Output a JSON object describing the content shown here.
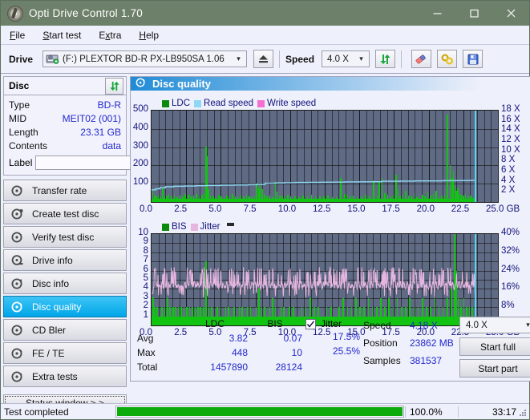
{
  "window": {
    "title": "Opti Drive Control 1.70",
    "icon": "disc-icon",
    "minimize": "–",
    "maximize": "☐",
    "close": "✕"
  },
  "menubar": {
    "items": [
      {
        "label": "File",
        "accel": "F"
      },
      {
        "label": "Start test",
        "accel": "S"
      },
      {
        "label": "Extra",
        "accel": "x"
      },
      {
        "label": "Help",
        "accel": "H"
      }
    ]
  },
  "toolbar": {
    "drive_label": "Drive",
    "drive_value": "(F:)  PLEXTOR BD-R  PX-LB950SA 1.06",
    "eject_icon": "eject-icon",
    "speed_label": "Speed",
    "speed_value": "4.0 X",
    "refresh_icon": "refresh-icon",
    "erase_icon": "eraser-icon",
    "tools_icon": "tools-icon",
    "save_icon": "save-icon"
  },
  "disc": {
    "title": "Disc",
    "refresh_icon": "refresh-icon",
    "rows": [
      {
        "key": "Type",
        "value": "BD-R"
      },
      {
        "key": "MID",
        "value": "MEIT02 (001)"
      },
      {
        "key": "Length",
        "value": "23.31 GB"
      },
      {
        "key": "Contents",
        "value": "data"
      }
    ],
    "label_key": "Label",
    "label_value": "",
    "label_placeholder": "",
    "label_button_icon": "cd-icon"
  },
  "sidebar": {
    "items": [
      {
        "label": "Transfer rate",
        "icon": "disc-test-icon",
        "active": false
      },
      {
        "label": "Create test disc",
        "icon": "disc-burn-icon",
        "active": false
      },
      {
        "label": "Verify test disc",
        "icon": "disc-verify-icon",
        "active": false
      },
      {
        "label": "Drive info",
        "icon": "drive-info-icon",
        "active": false
      },
      {
        "label": "Disc info",
        "icon": "disc-info-icon",
        "active": false
      },
      {
        "label": "Disc quality",
        "icon": "disc-quality-icon",
        "active": true
      },
      {
        "label": "CD Bler",
        "icon": "cd-bler-icon",
        "active": false
      },
      {
        "label": "FE / TE",
        "icon": "fe-te-icon",
        "active": false
      },
      {
        "label": "Extra tests",
        "icon": "extra-tests-icon",
        "active": false
      }
    ],
    "status_window_button": "Status window > >"
  },
  "pane": {
    "title": "Disc quality",
    "icon": "disc-quality-icon"
  },
  "stats": {
    "col_headers": [
      "",
      "LDC",
      "BIS"
    ],
    "rows": [
      {
        "label": "Avg",
        "ldc": "3.82",
        "bis": "0.07",
        "jitter": "17.5%"
      },
      {
        "label": "Max",
        "ldc": "448",
        "bis": "10",
        "jitter": "25.5%"
      },
      {
        "label": "Total",
        "ldc": "1457890",
        "bis": "28124",
        "jitter": ""
      }
    ],
    "jitter_label": "Jitter",
    "jitter_checked": true,
    "speed_label": "Speed",
    "speed_value": "4.18 X",
    "position_label": "Position",
    "position_value": "23862 MB",
    "samples_label": "Samples",
    "samples_value": "381537",
    "speed_select": "4.0 X",
    "start_full": "Start full",
    "start_part": "Start part"
  },
  "statusbar": {
    "text": "Test completed",
    "percent": "100.0%",
    "progress": 100,
    "time": "33:17"
  },
  "colors": {
    "titlebar": "#6d8069",
    "plot_bg": "#5f6b84",
    "ldc_green": "#12c412",
    "read_speed": "#8fd8f5",
    "write_speed": "#f56fd0",
    "jitter_pink": "#e7b6e0",
    "accent_blue": "#1f8bd6",
    "value_blue": "#2228cc",
    "progress_green": "#0bab0b"
  },
  "chart_data": [
    {
      "type": "line",
      "name": "top-chart-ldc-speed",
      "title": "",
      "xlabel": "GB",
      "ylabel": "LDC",
      "y2label": "X",
      "xlim": [
        0,
        25.0
      ],
      "ylim": [
        0,
        500
      ],
      "y2lim": [
        0,
        18
      ],
      "grid": true,
      "legend_position": "top-left",
      "xticks": [
        "0.0",
        "2.5",
        "5.0",
        "7.5",
        "10.0",
        "12.5",
        "15.0",
        "17.5",
        "20.0",
        "22.5",
        "25.0 GB"
      ],
      "xtick_values": [
        0,
        2.5,
        5,
        7.5,
        10,
        12.5,
        15,
        17.5,
        20,
        22.5,
        25
      ],
      "yticks": [
        "100",
        "200",
        "300",
        "400",
        "500"
      ],
      "ytick_values": [
        100,
        200,
        300,
        400,
        500
      ],
      "y2ticks": [
        "2 X",
        "4 X",
        "6 X",
        "8 X",
        "10 X",
        "12 X",
        "14 X",
        "16 X",
        "18 X"
      ],
      "y2tick_values": [
        2,
        4,
        6,
        8,
        10,
        12,
        14,
        16,
        18
      ],
      "legend": [
        {
          "name": "LDC",
          "color": "#0b8a0b"
        },
        {
          "name": "Read speed",
          "color": "#8fd8f5"
        },
        {
          "name": "Write speed",
          "color": "#f56fd0"
        }
      ],
      "series": [
        {
          "name": "LDC",
          "color": "#12c412",
          "type": "impulse",
          "x": [
            0.05,
            0.18,
            0.3,
            0.45,
            0.6,
            0.75,
            0.9,
            1.05,
            1.2,
            1.4,
            1.6,
            1.8,
            2.0,
            2.2,
            2.4,
            2.6,
            2.8,
            3.0,
            3.2,
            3.4,
            3.6,
            3.75,
            3.9,
            3.95,
            4.05,
            4.2,
            4.4,
            4.6,
            4.8,
            5.0,
            5.2,
            5.4,
            5.6,
            5.8,
            6.0,
            6.2,
            6.4,
            6.6,
            6.8,
            7.0,
            7.2,
            7.4,
            7.55,
            7.7,
            7.8,
            7.95,
            8.1,
            8.3,
            8.5,
            8.7,
            8.9,
            9.0,
            9.2,
            9.4,
            9.6,
            9.8,
            10.0,
            10.3,
            10.6,
            10.9,
            11.2,
            11.5,
            11.8,
            12.1,
            12.4,
            12.7,
            13.0,
            13.3,
            13.6,
            13.9,
            14.1,
            14.3,
            14.5,
            14.8,
            15.1,
            15.4,
            15.7,
            16.0,
            16.25,
            16.4,
            16.6,
            16.8,
            17.0,
            17.2,
            17.4,
            17.6,
            17.75,
            17.9,
            18.1,
            18.3,
            18.5,
            18.7,
            18.9,
            19.1,
            19.3,
            19.5,
            19.7,
            19.9,
            20.1,
            20.3,
            20.5,
            20.7,
            20.9,
            21.1,
            21.3,
            21.5,
            21.65,
            21.75,
            21.85,
            21.95,
            22.05,
            22.15,
            22.3,
            22.45,
            22.6,
            22.8,
            23.0,
            23.2,
            23.35
          ],
          "y": [
            70,
            35,
            30,
            40,
            28,
            80,
            30,
            35,
            45,
            30,
            40,
            28,
            35,
            30,
            45,
            38,
            30,
            35,
            42,
            30,
            38,
            50,
            303,
            250,
            70,
            35,
            30,
            28,
            40,
            32,
            28,
            35,
            30,
            42,
            30,
            28,
            35,
            30,
            38,
            30,
            25,
            35,
            100,
            75,
            95,
            70,
            40,
            30,
            35,
            28,
            110,
            55,
            35,
            30,
            28,
            40,
            32,
            30,
            28,
            35,
            30,
            40,
            28,
            32,
            30,
            35,
            28,
            30,
            130,
            45,
            40,
            30,
            35,
            28,
            32,
            40,
            30,
            120,
            35,
            115,
            130,
            50,
            40,
            30,
            38,
            150,
            70,
            30,
            40,
            60,
            35,
            30,
            45,
            28,
            35,
            40,
            30,
            55,
            35,
            45,
            60,
            30,
            35,
            40,
            480,
            200,
            130,
            170,
            90,
            60,
            75,
            50,
            40,
            35,
            45,
            30,
            35,
            28,
            20
          ]
        },
        {
          "name": "Read speed",
          "color": "#8fd8f5",
          "type": "step",
          "x": [
            0.0,
            0.3,
            0.6,
            1.0,
            1.6,
            2.4,
            3.2,
            4.0,
            5.0,
            6.0,
            7.0,
            7.6,
            8.2,
            8.9,
            9.6,
            10.4,
            11.3,
            12.2,
            13.1,
            14.0,
            15.0,
            16.0,
            16.6,
            17.2,
            18.0,
            19.0,
            20.0,
            21.0,
            22.0,
            23.0,
            23.35
          ],
          "y": [
            2.4,
            2.6,
            2.8,
            3.0,
            3.1,
            3.15,
            3.2,
            3.25,
            3.3,
            3.35,
            3.4,
            3.45,
            3.7,
            3.75,
            3.8,
            3.85,
            3.88,
            3.9,
            3.92,
            3.95,
            3.97,
            4.0,
            4.1,
            4.1,
            4.12,
            4.15,
            4.15,
            4.2,
            4.22,
            4.25,
            4.25
          ]
        },
        {
          "name": "Write speed",
          "color": "#f56fd0",
          "type": "step",
          "x": [],
          "y": []
        }
      ],
      "markers": [
        {
          "type": "vline",
          "x": 23.35,
          "color": "#57d2f7"
        }
      ]
    },
    {
      "type": "line",
      "name": "bottom-chart-bis-jitter",
      "title": "",
      "xlabel": "GB",
      "ylabel": "BIS",
      "y2label": "%",
      "xlim": [
        0,
        25.0
      ],
      "ylim": [
        0,
        10
      ],
      "y2lim": [
        0,
        40
      ],
      "grid": true,
      "legend_position": "top-left",
      "xticks": [
        "0.0",
        "2.5",
        "5.0",
        "7.5",
        "10.0",
        "12.5",
        "15.0",
        "17.5",
        "20.0",
        "22.5",
        "25.0 GB"
      ],
      "xtick_values": [
        0,
        2.5,
        5,
        7.5,
        10,
        12.5,
        15,
        17.5,
        20,
        22.5,
        25
      ],
      "yticks": [
        "1",
        "2",
        "3",
        "4",
        "5",
        "6",
        "7",
        "8",
        "9",
        "10"
      ],
      "ytick_values": [
        1,
        2,
        3,
        4,
        5,
        6,
        7,
        8,
        9,
        10
      ],
      "y2ticks": [
        "8%",
        "16%",
        "24%",
        "32%",
        "40%"
      ],
      "y2tick_values": [
        8,
        16,
        24,
        32,
        40
      ],
      "legend": [
        {
          "name": "BIS",
          "color": "#0b8a0b"
        },
        {
          "name": "Jitter",
          "color": "#e7b6e0"
        }
      ],
      "series": [
        {
          "name": "BIS",
          "color": "#12c412",
          "type": "impulse",
          "baseline": 1.0,
          "x": [
            0.08,
            0.2,
            0.35,
            0.5,
            0.7,
            0.9,
            1.1,
            1.3,
            1.5,
            1.7,
            1.9,
            2.1,
            2.3,
            2.5,
            2.7,
            2.9,
            3.1,
            3.3,
            3.5,
            3.7,
            3.9,
            4.1,
            4.3,
            4.5,
            4.7,
            4.9,
            5.1,
            5.3,
            5.5,
            5.7,
            5.9,
            6.1,
            6.3,
            6.5,
            6.7,
            6.9,
            7.1,
            7.3,
            7.5,
            7.7,
            7.9,
            8.1,
            8.3,
            8.5,
            8.7,
            8.9,
            9.1,
            9.3,
            9.5,
            9.7,
            9.9,
            10.2,
            10.5,
            10.8,
            11.1,
            11.4,
            11.7,
            12.0,
            12.3,
            12.6,
            12.9,
            13.2,
            13.5,
            13.8,
            14.1,
            14.4,
            14.7,
            15.0,
            15.3,
            15.6,
            15.9,
            16.2,
            16.5,
            16.8,
            17.1,
            17.4,
            17.7,
            18.0,
            18.3,
            18.6,
            18.9,
            19.2,
            19.5,
            19.8,
            20.1,
            20.4,
            20.7,
            21.0,
            21.3,
            21.6,
            21.8,
            21.85,
            21.95,
            22.1,
            22.3,
            22.5,
            22.7,
            22.9,
            23.1,
            23.3
          ],
          "y": [
            3.1,
            2.0,
            2.0,
            1.0,
            2.0,
            2.0,
            3.0,
            2.0,
            2.0,
            2.0,
            2.0,
            2.0,
            2.0,
            2.0,
            2.0,
            2.0,
            2.0,
            2.0,
            2.0,
            2.0,
            7.0,
            2.0,
            2.0,
            1.0,
            2.0,
            2.0,
            1.0,
            2.0,
            2.0,
            1.0,
            2.0,
            1.0,
            2.0,
            2.0,
            1.0,
            2.0,
            2.0,
            1.0,
            2.0,
            4.0,
            2.0,
            2.0,
            1.0,
            2.0,
            3.0,
            2.0,
            1.0,
            2.0,
            2.0,
            1.0,
            2.0,
            2.0,
            1.0,
            2.0,
            2.0,
            3.0,
            2.0,
            2.0,
            1.0,
            2.0,
            2.0,
            1.0,
            2.0,
            3.0,
            2.0,
            2.0,
            3.0,
            2.0,
            2.0,
            3.0,
            2.0,
            2.0,
            3.0,
            2.0,
            3.0,
            2.0,
            3.0,
            2.0,
            2.0,
            3.0,
            2.0,
            2.0,
            3.0,
            2.0,
            2.0,
            3.0,
            2.0,
            2.0,
            3.0,
            4.0,
            10.0,
            10.0,
            6.0,
            3.0,
            2.0,
            3.0,
            2.0,
            2.0,
            2.0,
            2.0
          ]
        },
        {
          "name": "Jitter",
          "color": "#e7b6e0",
          "type": "line",
          "unit": "%",
          "mean": 17.5,
          "max": 25.5,
          "min_approx": 13.0,
          "description": "Dense oscillating trace averaging ~4.4 on the 0-10 scale (17.5%), peaking near 6.5 (25.5%)"
        }
      ],
      "markers": [
        {
          "type": "vline",
          "x": 23.35,
          "color": "#57d2f7"
        }
      ]
    }
  ]
}
